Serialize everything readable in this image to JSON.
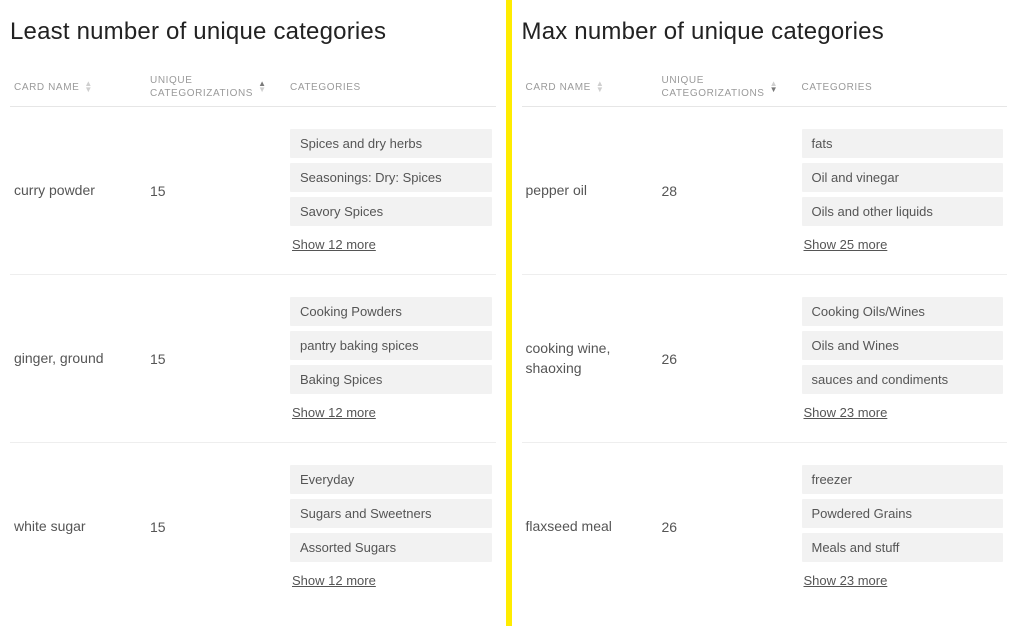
{
  "left": {
    "title": "Least number of unique categories",
    "columns": {
      "card_name": "CARD NAME",
      "unique": "UNIQUE\nCATEGORIZATIONS",
      "categories": "CATEGORIES"
    },
    "sort": {
      "column": "unique",
      "direction": "asc"
    },
    "rows": [
      {
        "name": "curry powder",
        "unique": "15",
        "tags": [
          "Spices and dry herbs",
          "Seasonings: Dry: Spices",
          "Savory Spices"
        ],
        "more": "Show 12 more"
      },
      {
        "name": "ginger, ground",
        "unique": "15",
        "tags": [
          "Cooking Powders",
          "pantry baking spices",
          "Baking Spices"
        ],
        "more": "Show 12 more"
      },
      {
        "name": "white sugar",
        "unique": "15",
        "tags": [
          "Everyday",
          "Sugars and Sweetners",
          "Assorted Sugars"
        ],
        "more": "Show 12 more"
      }
    ]
  },
  "right": {
    "title": "Max number of unique categories",
    "columns": {
      "card_name": "CARD NAME",
      "unique": "UNIQUE\nCATEGORIZATIONS",
      "categories": "CATEGORIES"
    },
    "sort": {
      "column": "unique",
      "direction": "desc"
    },
    "rows": [
      {
        "name": "pepper oil",
        "unique": "28",
        "tags": [
          "fats",
          "Oil and vinegar",
          "Oils and other liquids"
        ],
        "more": "Show 25 more"
      },
      {
        "name": "cooking wine, shaoxing",
        "unique": "26",
        "tags": [
          "Cooking Oils/Wines",
          "Oils and Wines",
          "sauces and condiments"
        ],
        "more": "Show 23 more"
      },
      {
        "name": "flaxseed meal",
        "unique": "26",
        "tags": [
          "freezer",
          "Powdered Grains",
          "Meals and stuff"
        ],
        "more": "Show 23 more"
      }
    ]
  }
}
